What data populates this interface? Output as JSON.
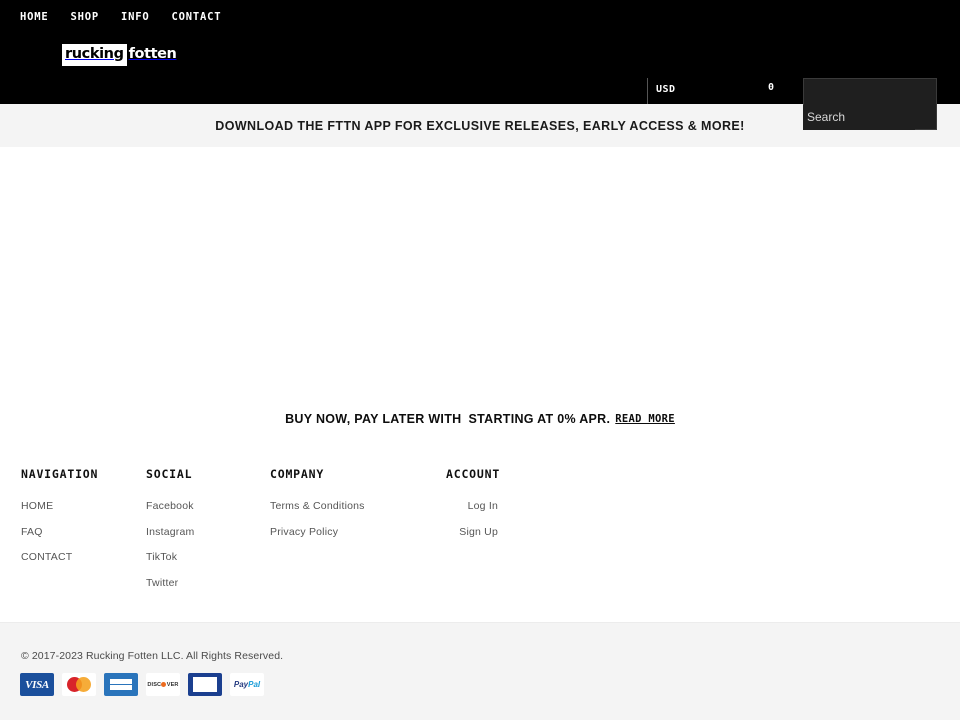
{
  "header": {
    "nav": [
      {
        "label": "HOME"
      },
      {
        "label": "SHOP"
      },
      {
        "label": "INFO"
      },
      {
        "label": "CONTACT"
      }
    ],
    "logo": {
      "part_one": "rucking",
      "part_two": "fotten"
    },
    "currency": "USD",
    "cart_count": "0",
    "search": {
      "value": "",
      "placeholder": "Search"
    }
  },
  "announcement": {
    "text": "DOWNLOAD THE FTTN APP FOR EXCLUSIVE RELEASES, EARLY ACCESS & MORE!"
  },
  "finance": {
    "text_before": "BUY NOW, PAY LATER WITH",
    "text_after": "STARTING AT 0% APR.",
    "link_label": "READ MORE"
  },
  "footer": {
    "columns": [
      {
        "heading": "NAVIGATION",
        "links": [
          {
            "label": "HOME"
          },
          {
            "label": "FAQ"
          },
          {
            "label": "CONTACT"
          }
        ]
      },
      {
        "heading": "SOCIAL",
        "links": [
          {
            "label": "Facebook"
          },
          {
            "label": "Instagram"
          },
          {
            "label": "TikTok"
          },
          {
            "label": "Twitter"
          }
        ]
      },
      {
        "heading": "COMPANY",
        "links": [
          {
            "label": "Terms & Conditions"
          },
          {
            "label": "Privacy Policy"
          }
        ]
      },
      {
        "heading": "ACCOUNT",
        "links": [
          {
            "label": "Log In"
          },
          {
            "label": "Sign Up"
          }
        ]
      }
    ]
  },
  "bottom": {
    "copyright": "© 2017-2023 Rucking Fotten LLC. All Rights Reserved.",
    "payment_methods": [
      {
        "name": "visa-icon",
        "label": "VISA"
      },
      {
        "name": "mastercard-icon",
        "label": ""
      },
      {
        "name": "american-express-icon",
        "label": "AMERICAN EXPRESS"
      },
      {
        "name": "discover-icon",
        "label": "DISC"
      },
      {
        "name": "generic-card-icon",
        "label": ""
      },
      {
        "name": "paypal-icon",
        "label": "PayPal"
      }
    ],
    "discover_suffix": "VER",
    "paypal_part_one": "Pay",
    "paypal_part_two": "Pal"
  },
  "colors": {
    "header_bg": "#000000",
    "announce_bg": "#f4f4f4",
    "bottom_bg": "#f4f4f4",
    "search_bg": "#1f1f1f",
    "text_light": "#555555"
  }
}
